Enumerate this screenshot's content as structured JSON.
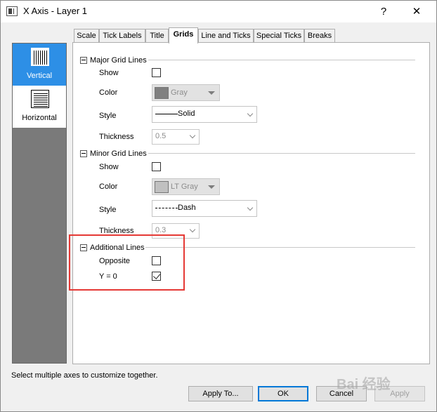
{
  "window": {
    "title": "X Axis - Layer 1",
    "help_label": "?",
    "close_label": "✕"
  },
  "tabs": [
    {
      "label": "Scale"
    },
    {
      "label": "Tick Labels"
    },
    {
      "label": "Title"
    },
    {
      "label": "Grids",
      "active": true
    },
    {
      "label": "Line and Ticks"
    },
    {
      "label": "Special Ticks"
    },
    {
      "label": "Breaks"
    }
  ],
  "side_list": [
    {
      "label": "Vertical",
      "icon": "vertical-grid-icon",
      "selected": true
    },
    {
      "label": "Horizontal",
      "icon": "horizontal-grid-icon",
      "selected": false
    }
  ],
  "major": {
    "heading": "Major Grid Lines",
    "show_label": "Show",
    "show_checked": false,
    "color_label": "Color",
    "color_value": "Gray",
    "color_hex": "#808080",
    "style_label": "Style",
    "style_value": "Solid",
    "thickness_label": "Thickness",
    "thickness_value": "0.5"
  },
  "minor": {
    "heading": "Minor Grid Lines",
    "show_label": "Show",
    "show_checked": false,
    "color_label": "Color",
    "color_value": "LT Gray",
    "color_hex": "#c0c0c0",
    "style_label": "Style",
    "style_value": "Dash",
    "thickness_label": "Thickness",
    "thickness_value": "0.3"
  },
  "additional": {
    "heading": "Additional Lines",
    "opposite_label": "Opposite",
    "opposite_checked": false,
    "y0_label": "Y = 0",
    "y0_checked": true
  },
  "footer": {
    "hint": "Select multiple axes to customize together.",
    "apply_to_label": "Apply To...",
    "ok_label": "OK",
    "cancel_label": "Cancel",
    "apply_label": "Apply"
  },
  "accent_color": "#2d8fe6",
  "highlight_color": "#e53935",
  "watermark_text": "Bai 经验"
}
